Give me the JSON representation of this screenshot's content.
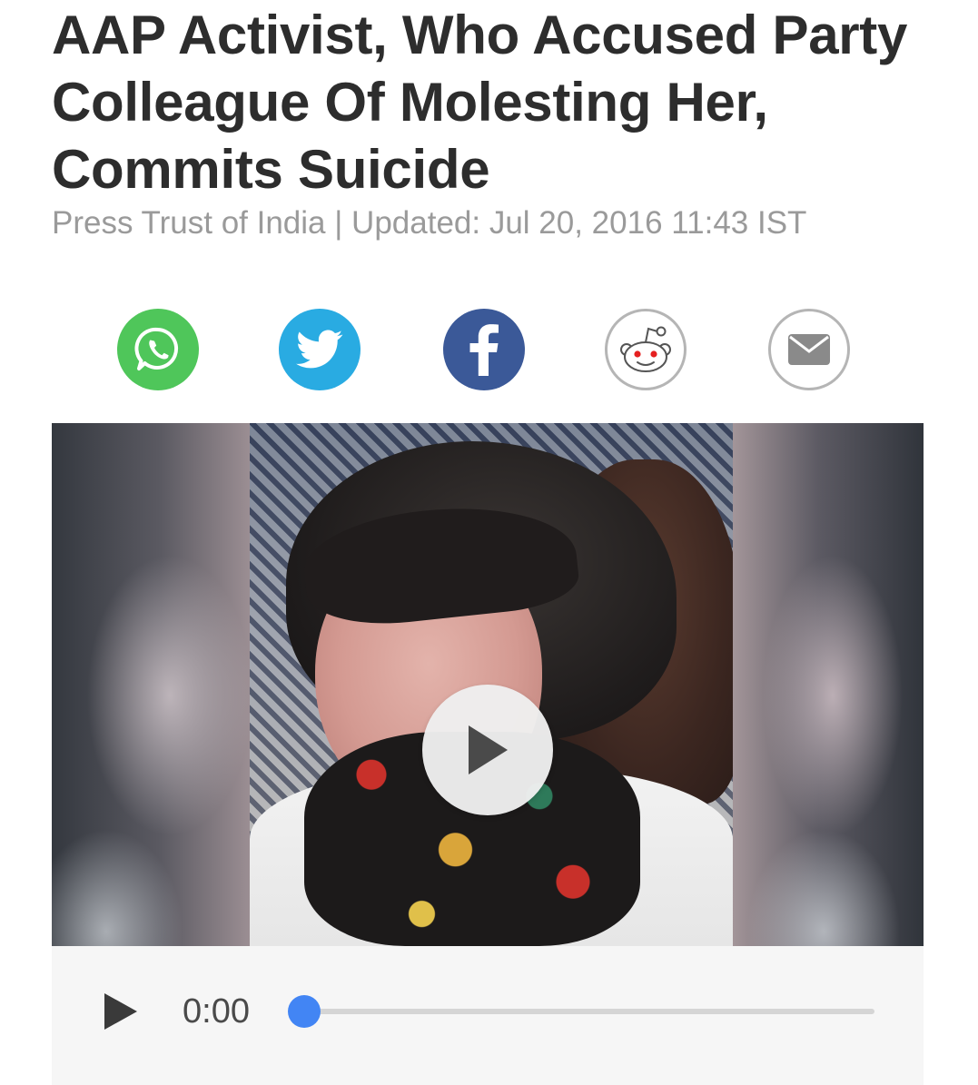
{
  "article": {
    "headline": "AAP Activist, Who Accused Party Colleague Of Molesting Her, Commits Suicide",
    "byline": "Press Trust of India | Updated: Jul 20, 2016 11:43 IST"
  },
  "share": {
    "buttons": [
      {
        "name": "whatsapp",
        "icon": "whatsapp-icon",
        "color": "#4fc65a"
      },
      {
        "name": "twitter",
        "icon": "twitter-bird-icon",
        "color": "#29abe2"
      },
      {
        "name": "facebook",
        "icon": "facebook-f-icon",
        "color": "#3b5998"
      },
      {
        "name": "reddit",
        "icon": "reddit-alien-icon",
        "color": "#ffffff"
      },
      {
        "name": "email",
        "icon": "envelope-icon",
        "color": "#ffffff"
      }
    ]
  },
  "player": {
    "current_time": "0:00",
    "progress": 0,
    "accent_color": "#4285f4"
  }
}
